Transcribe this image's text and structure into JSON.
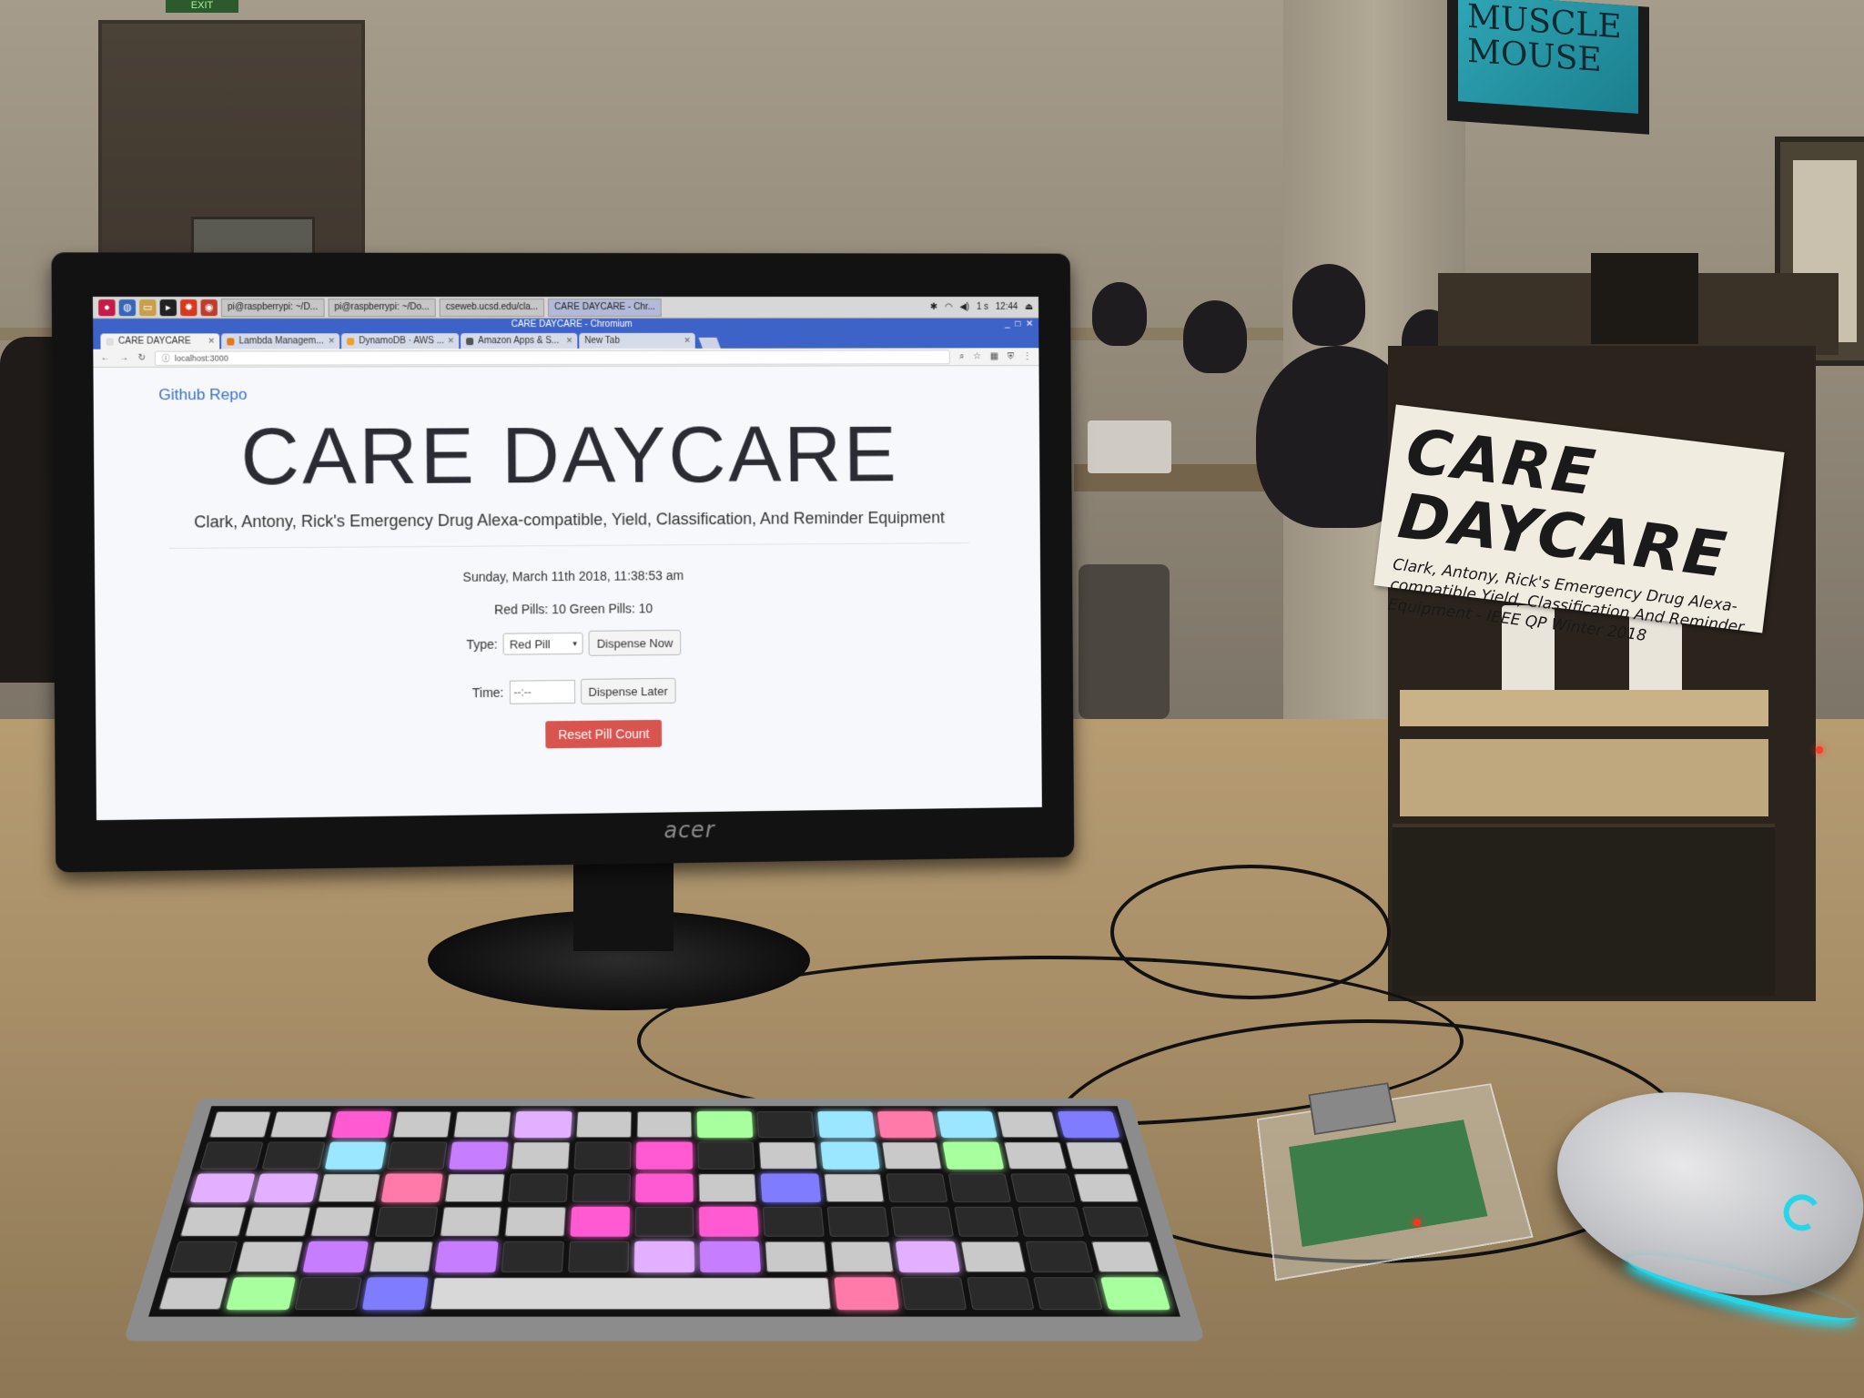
{
  "scene": {
    "taskbar": {
      "tasks": [
        "pi@raspberrypi: ~/D...",
        "pi@raspberrypi: ~/Do...",
        "cseweb.ucsd.edu/cla...",
        "CARE DAYCARE - Chr..."
      ],
      "clock": "12:44",
      "indicator": "1 s"
    },
    "window_title": "CARE DAYCARE - Chromium",
    "tabs": [
      {
        "label": "CARE DAYCARE",
        "color": "#dddddd"
      },
      {
        "label": "Lambda Managem...",
        "color": "#e47911"
      },
      {
        "label": "DynamoDB · AWS ...",
        "color": "#f0a030"
      },
      {
        "label": "Amazon Apps & S...",
        "color": "#555555"
      },
      {
        "label": "New Tab",
        "color": "#cccccc"
      }
    ],
    "url": "localhost:3000",
    "page": {
      "github_link": "Github Repo",
      "title": "CARE DAYCARE",
      "subtitle": "Clark, Antony, Rick's Emergency Drug Alexa-compatible, Yield, Classification, And Reminder Equipment",
      "datetime": "Sunday, March 11th 2018, 11:38:53 am",
      "pill_counts": "Red Pills: 10 Green Pills: 10",
      "type_label": "Type:",
      "type_selected": "Red Pill",
      "dispense_now": "Dispense Now",
      "time_label": "Time:",
      "time_value": "--:--",
      "dispense_later": "Dispense Later",
      "reset_button": "Reset Pill Count",
      "reset_color": "#d9534f",
      "link_color": "#3b6fc4"
    },
    "monitor_brand": "acer",
    "wall_tv_text": "MUSCLE MOUSE",
    "exit_sign": "EXIT",
    "box_sign": {
      "title": "CARE DAYCARE",
      "subtitle": "Clark, Antony, Rick's Emergency Drug Alexa-compatible Yield, Classification And Reminder Equipment - IEEE QP Winter 2018"
    },
    "colors": {
      "mouse_glow": "#26d6e8"
    }
  }
}
